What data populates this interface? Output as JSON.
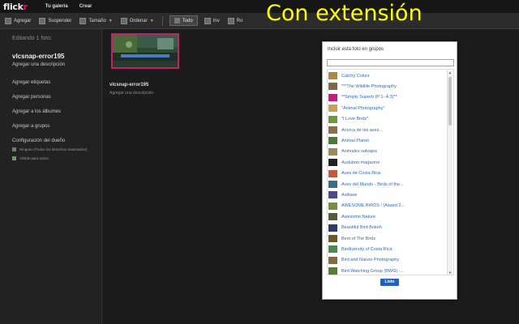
{
  "topbar": {
    "logo_main": "flick",
    "logo_r": "r",
    "nav": [
      "Tu galería",
      "Crear"
    ]
  },
  "toolbar": {
    "agregar": "Agregar",
    "suspender": "Suspender",
    "tamano": "Tamaño",
    "ordenar": "Ordenar",
    "todo": "Todo",
    "partial_1": "Inv",
    "partial_2": "Ro"
  },
  "overlay_title": "Con extensión",
  "sidebar": {
    "editing": "Editando 1 foto:",
    "photo_name": "vlcsnap-error195",
    "add_description": "Agregar una descripción",
    "actions": [
      "Agregar etiquetas",
      "Agregar personas",
      "Agregar a los álbumes",
      "Agregar a grupos"
    ],
    "owner_settings": "Configuración del dueño",
    "license": "Ninguno (Todos los derechos reservados)",
    "visibility": "Visible para todos"
  },
  "content": {
    "photo_title": "vlcsnap-error195",
    "photo_desc": "Agregar una descripción"
  },
  "dialog": {
    "title": "Incluir esta foto en grupos",
    "search_value": "",
    "button": "Listo",
    "groups": [
      {
        "name": "Catchy Colors",
        "color": "#b08a3a"
      },
      {
        "name": "***The Wildlife Photography",
        "color": "#7a6a4a"
      },
      {
        "name": "**Simply Superb (P 1- A 3)**",
        "color": "#c0207a"
      },
      {
        "name": "\"Animal Photography\"",
        "color": "#c8a050"
      },
      {
        "name": "\"I Love Birds\"",
        "color": "#6a9a3a"
      },
      {
        "name": "Acerca de las aves...",
        "color": "#8a7050"
      },
      {
        "name": "Animal Planet",
        "color": "#4a7a3a"
      },
      {
        "name": "Animales salvajes",
        "color": "#9a8a5a"
      },
      {
        "name": "Audubon magazine",
        "color": "#222222"
      },
      {
        "name": "Aves de Costa Rica",
        "color": "#c05a3a"
      },
      {
        "name": "Aves del Mundo - Birds of the...",
        "color": "#3a6a8a"
      },
      {
        "name": "Avibase",
        "color": "#4a4a8a"
      },
      {
        "name": "AWESOME BIRDS ! (Award 2...",
        "color": "#7a8a4a"
      },
      {
        "name": "Awesome Nature",
        "color": "#5a5a3a"
      },
      {
        "name": "Beautiful Bird Bokeh",
        "color": "#2a3a6a"
      },
      {
        "name": "Best of The Birds",
        "color": "#6a5a2a"
      },
      {
        "name": "Biodiversity of Costa Rica",
        "color": "#4a8a4a"
      },
      {
        "name": "Bird and Nature Photography",
        "color": "#8a6a3a"
      },
      {
        "name": "Bird Watching Group (BWG) -...",
        "color": "#5a7a3a"
      },
      {
        "name": "",
        "color": "#7a7a5a"
      }
    ]
  }
}
